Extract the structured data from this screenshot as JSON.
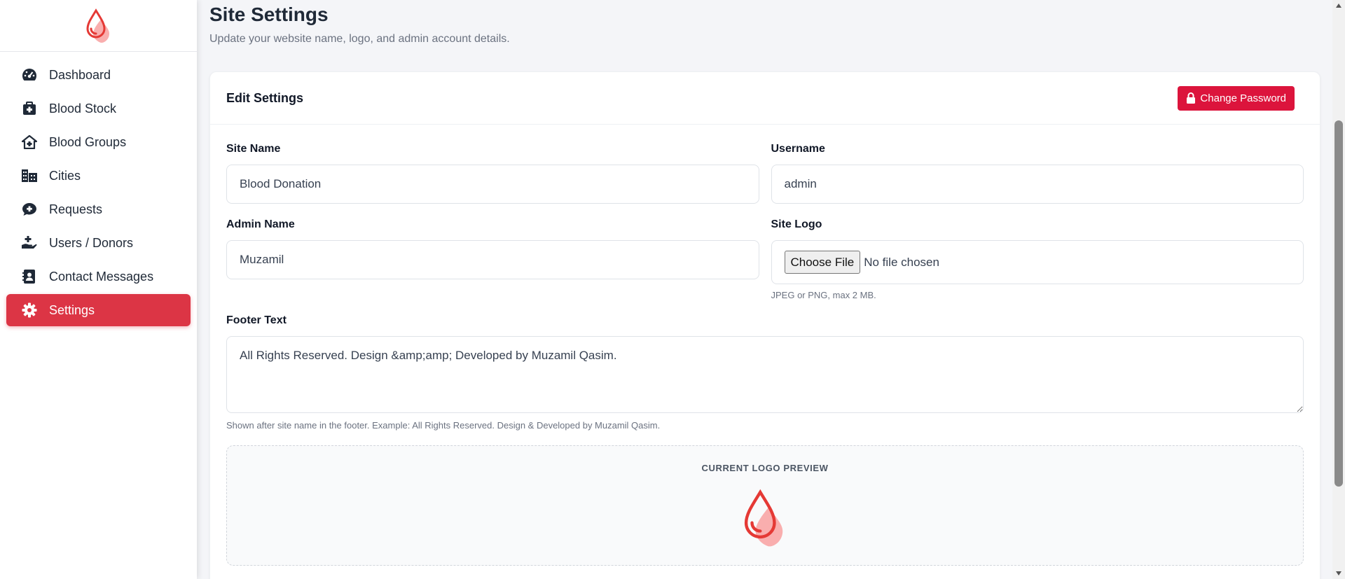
{
  "sidebar": {
    "items": [
      {
        "label": "Dashboard",
        "icon": "gauge-icon"
      },
      {
        "label": "Blood Stock",
        "icon": "medkit-icon"
      },
      {
        "label": "Blood Groups",
        "icon": "house-medical-icon"
      },
      {
        "label": "Cities",
        "icon": "city-icon"
      },
      {
        "label": "Requests",
        "icon": "comment-medical-icon"
      },
      {
        "label": "Users / Donors",
        "icon": "hand-holding-medical-icon"
      },
      {
        "label": "Contact Messages",
        "icon": "address-book-icon"
      },
      {
        "label": "Settings",
        "icon": "gear-icon"
      }
    ],
    "active": "Settings"
  },
  "header": {
    "title": "Site Settings",
    "subtitle": "Update your website name, logo, and admin account details."
  },
  "card": {
    "title": "Edit Settings",
    "change_password_label": "Change Password"
  },
  "form": {
    "site_name": {
      "label": "Site Name",
      "value": "Blood Donation"
    },
    "username": {
      "label": "Username",
      "value": "admin"
    },
    "admin_name": {
      "label": "Admin Name",
      "value": "Muzamil"
    },
    "site_logo": {
      "label": "Site Logo",
      "button": "Choose File",
      "status": "No file chosen",
      "help": "JPEG or PNG, max 2 MB."
    },
    "footer_text": {
      "label": "Footer Text",
      "value": "All Rights Reserved. Design &amp;amp; Developed by Muzamil Qasim.",
      "help": "Shown after site name in the footer. Example: All Rights Reserved. Design & Developed by Muzamil Qasim."
    }
  },
  "preview": {
    "title": "CURRENT LOGO PREVIEW"
  },
  "colors": {
    "accent": "#dc3545",
    "button": "#dc143c",
    "logo_red": "#e53935",
    "logo_pink": "#f8a5a5"
  }
}
